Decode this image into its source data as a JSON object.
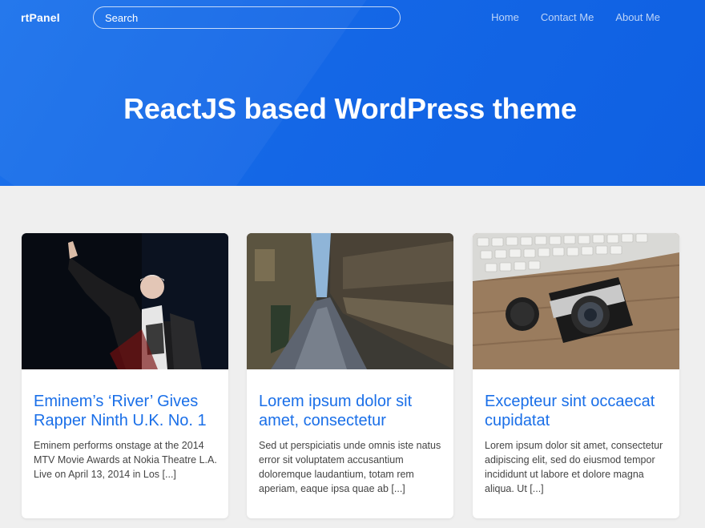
{
  "header": {
    "logo": "rtPanel",
    "search_placeholder": "Search",
    "nav": [
      "Home",
      "Contact Me",
      "About Me"
    ]
  },
  "hero": {
    "title": "ReactJS based WordPress theme"
  },
  "posts": [
    {
      "title": "Eminem’s ‘River’ Gives Rapper Ninth U.K. No. 1",
      "excerpt": "Eminem performs onstage at the 2014 MTV Movie Awards at Nokia Theatre L.A. Live on April 13, 2014 in Los [...]",
      "image": "performer-photo"
    },
    {
      "title": "Lorem ipsum dolor sit amet, consectetur",
      "excerpt": "Sed ut perspiciatis unde omnis iste natus error sit voluptatem accusantium doloremque laudantium, totam rem aperiam, eaque ipsa quae ab [...]",
      "image": "alley-photo"
    },
    {
      "title": "Excepteur sint occaecat cupidatat",
      "excerpt": "Lorem ipsum dolor sit amet, consectetur adipiscing elit, sed do eiusmod tempor incididunt ut labore et dolore magna aliqua. Ut [...]",
      "image": "camera-photo"
    }
  ],
  "colors": {
    "accent": "#1a6fe8",
    "hero_bg": "#1467e6",
    "page_bg": "#efefef"
  }
}
